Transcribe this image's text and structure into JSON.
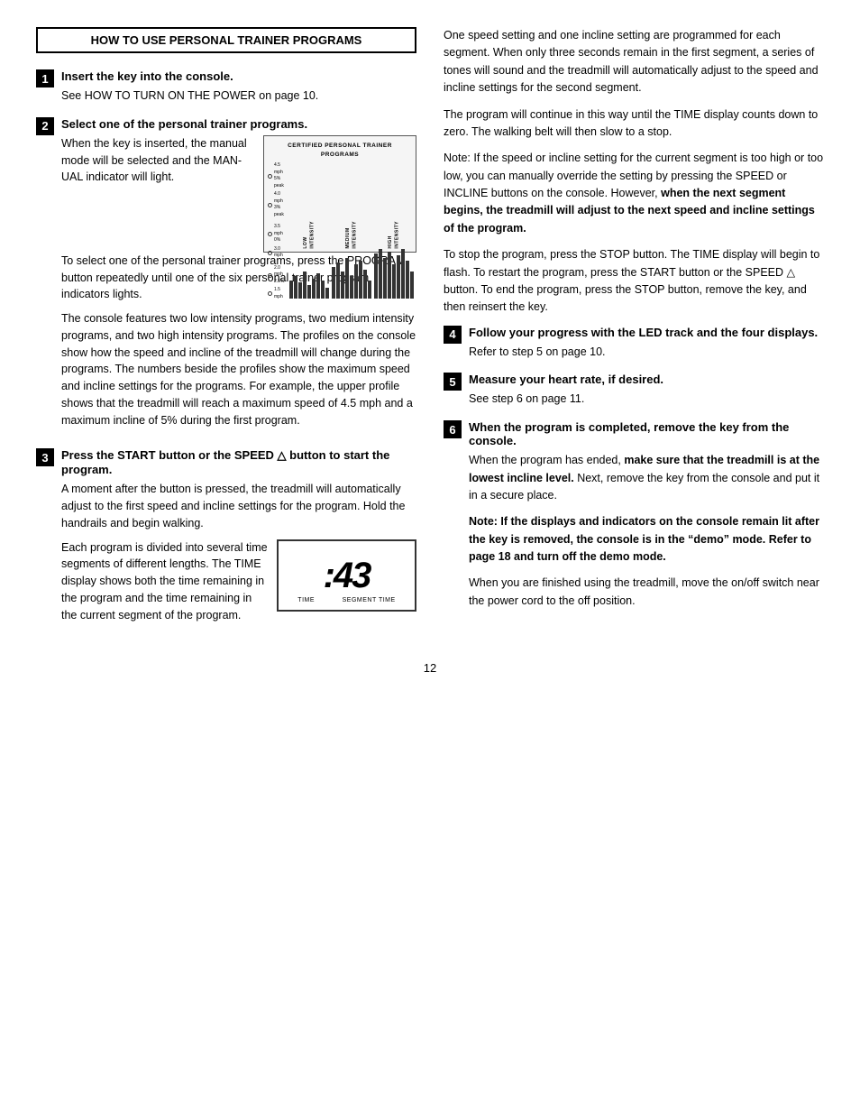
{
  "header": {
    "title": "HOW TO USE PERSONAL TRAINER PROGRAMS"
  },
  "left": {
    "step1": {
      "number": "1",
      "title": "Insert the key into the console.",
      "body": "See HOW TO TURN ON THE POWER on page 10."
    },
    "step2": {
      "number": "2",
      "title": "Select one of the personal trainer programs.",
      "body1": "When the key is inserted, the manual mode will be selected and the MAN-UAL indicator will light.",
      "body2": "To select one of the personal trainer programs, press the PROGRAM button repeatedly until one of the six personal trainer program indicators lights.",
      "body3": "The console features two low intensity programs, two medium intensity programs, and two high intensity programs. The profiles on the console show how the speed and incline of the treadmill will change during the programs. The numbers beside the profiles show the maximum speed and incline settings for the programs. For example, the upper profile shows that the treadmill will reach a maximum speed of 4.5 mph and a maximum incline of 5% during the first program."
    },
    "step3": {
      "number": "3",
      "title": "Press the START button or the SPEED △ button to start the program.",
      "body1": "A moment after the button is pressed, the treadmill will automatically adjust to the first speed and incline settings for the program. Hold the handrails and begin walking.",
      "body2": "Each program is divided into several time segments of different lengths. The TIME display shows both the time remaining in the program and the time remaining in the current segment of the program."
    }
  },
  "right": {
    "body1": "One speed setting and one incline setting are programmed for each segment. When only three seconds remain in the first segment, a series of tones will sound and the treadmill will automatically adjust to the speed and incline settings for the second segment.",
    "body2": "The program will continue in this way until the TIME display counts down to zero. The walking belt will then slow to a stop.",
    "body3": "Note: If the speed or incline setting for the current segment is too high or too low, you can manually override the setting by pressing the SPEED or INCLINE buttons on the console. However,",
    "body3_bold": "when the next segment begins, the treadmill will adjust to the next speed and incline settings of the program.",
    "body4": "To stop the program, press the STOP button. The TIME display will begin to flash. To restart the program, press the START button or the SPEED △ button. To end the program, press the STOP button, remove the key, and then reinsert the key.",
    "step4": {
      "number": "4",
      "title": "Follow your progress with the LED track and the four displays.",
      "body": "Refer to step 5 on page 10."
    },
    "step5": {
      "number": "5",
      "title": "Measure your heart rate, if desired.",
      "body": "See step 6 on page 11."
    },
    "step6": {
      "number": "6",
      "title": "When the program is completed, remove the key from the console.",
      "body1": "When the program has ended,",
      "body1_bold": "make sure that the treadmill is at the lowest incline level.",
      "body1_cont": "Next, remove the key from the console and put it in a secure place.",
      "body2_prefix": "Note: If the displays and indicators on the console remain lit after the key is removed, the console is in the “demo” mode. Refer to page 18 and turn off the demo mode.",
      "body3": "When you are finished using the treadmill, move the on/off switch near the power cord to the off position."
    }
  },
  "time_display": {
    "value": ":43",
    "label_left": "TIME",
    "label_right": "SEGMENT TIME"
  },
  "console_image": {
    "title": "CERTIFIED PERSONAL TRAINER PROGRAMS",
    "labels": [
      "4.5 mph / 5% peak",
      "4.0 mph / 3% peak",
      "3.5 mph / 0%",
      "3.0 mph",
      "2.0 mph",
      "1.5 mph"
    ],
    "intensities": [
      "LOW INTENSITY",
      "MEDIUM INTENSITY",
      "HIGH INTENSITY"
    ]
  },
  "page_number": "12"
}
